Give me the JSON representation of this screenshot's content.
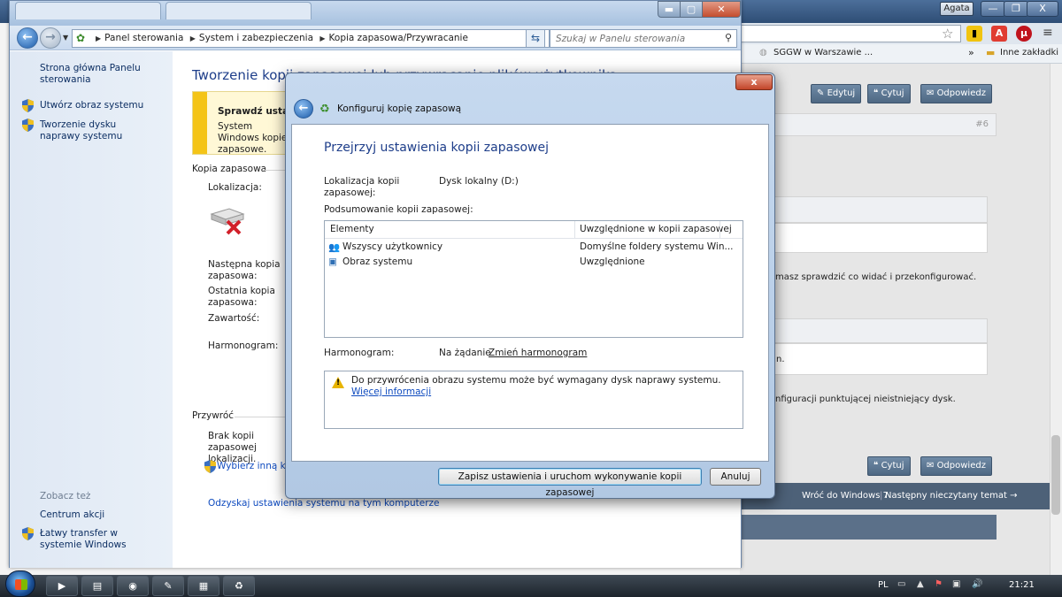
{
  "chrome": {
    "user_label": "Agata",
    "window_controls": {
      "minimize": "—",
      "restore": "❐",
      "close": "X"
    },
    "bookmarks": {
      "item1": "SGGW w Warszawie ...",
      "more": "»",
      "other": "Inne zakładki"
    },
    "forum": {
      "edit": "Edytuj",
      "quote": "Cytuj",
      "reply": "Odpowiedz",
      "post_number": "#6",
      "text1": "masz sprawdzić co widać i przekonfigurować.",
      "text2": "n.",
      "text3": "nfiguracji punktującej nieistniejący dysk.",
      "quote2": "Cytuj",
      "reply2": "Odpowiedz",
      "back_link": "Wróć do Windows 7",
      "next_link": "Następny nieczytany temat →"
    }
  },
  "control_panel": {
    "breadcrumbs": [
      "Panel sterowania",
      "System i zabezpieczenia",
      "Kopia zapasowa/Przywracanie"
    ],
    "search_placeholder": "Szukaj w Panelu sterowania",
    "sidebar": {
      "home": "Strona główna Panelu sterowania",
      "items": [
        "Utwórz obraz systemu",
        "Tworzenie dysku naprawy systemu"
      ],
      "see_also_title": "Zobacz też",
      "see_also": [
        "Centrum akcji",
        "Łatwy transfer w systemie Windows"
      ]
    },
    "title": "Tworzenie kopii zapasowej lub przywracanie plików użytkownika",
    "warning": {
      "title": "Sprawdź ustawi",
      "body": "System Windows kopie zapasowe."
    },
    "backup_group": "Kopia zapasowa",
    "fields": {
      "location": "Lokalizacja:",
      "next_backup": "Następna kopia zapasowa:",
      "last_backup": "Ostatnia kopia zapasowa:",
      "contents": "Zawartość:",
      "schedule": "Harmonogram:"
    },
    "restore_group": "Przywróć",
    "restore_text": "Brak kopii zapasowej lokalizacji.",
    "restore_link": "Wybierz inną kop",
    "restore_all_link": "Odzyskaj ustawienia systemu na tym komputerze"
  },
  "dialog": {
    "close": "x",
    "window_title": "Konfiguruj kopię zapasową",
    "heading": "Przejrzyj ustawienia kopii zapasowej",
    "location_label": "Lokalizacja kopii zapasowej:",
    "location_value": "Dysk lokalny (D:)",
    "summary_label": "Podsumowanie kopii zapasowej:",
    "table": {
      "headers": [
        "Elementy",
        "Uwzględnione w kopii zapasowej"
      ],
      "rows": [
        {
          "name": "Wszyscy użytkownicy",
          "included": "Domyślne foldery systemu Win..."
        },
        {
          "name": "Obraz systemu",
          "included": "Uwzględnione"
        }
      ]
    },
    "schedule_label": "Harmonogram:",
    "schedule_value": "Na żądanie",
    "schedule_link": "Zmień harmonogram",
    "warning_text": "Do przywrócenia obrazu systemu może być wymagany dysk naprawy systemu.",
    "warning_link": "Więcej informacji",
    "save_button": "Zapisz ustawienia i uruchom wykonywanie kopii zapasowej",
    "cancel_button": "Anuluj"
  },
  "taskbar": {
    "language": "PL",
    "clock": "21:21"
  }
}
